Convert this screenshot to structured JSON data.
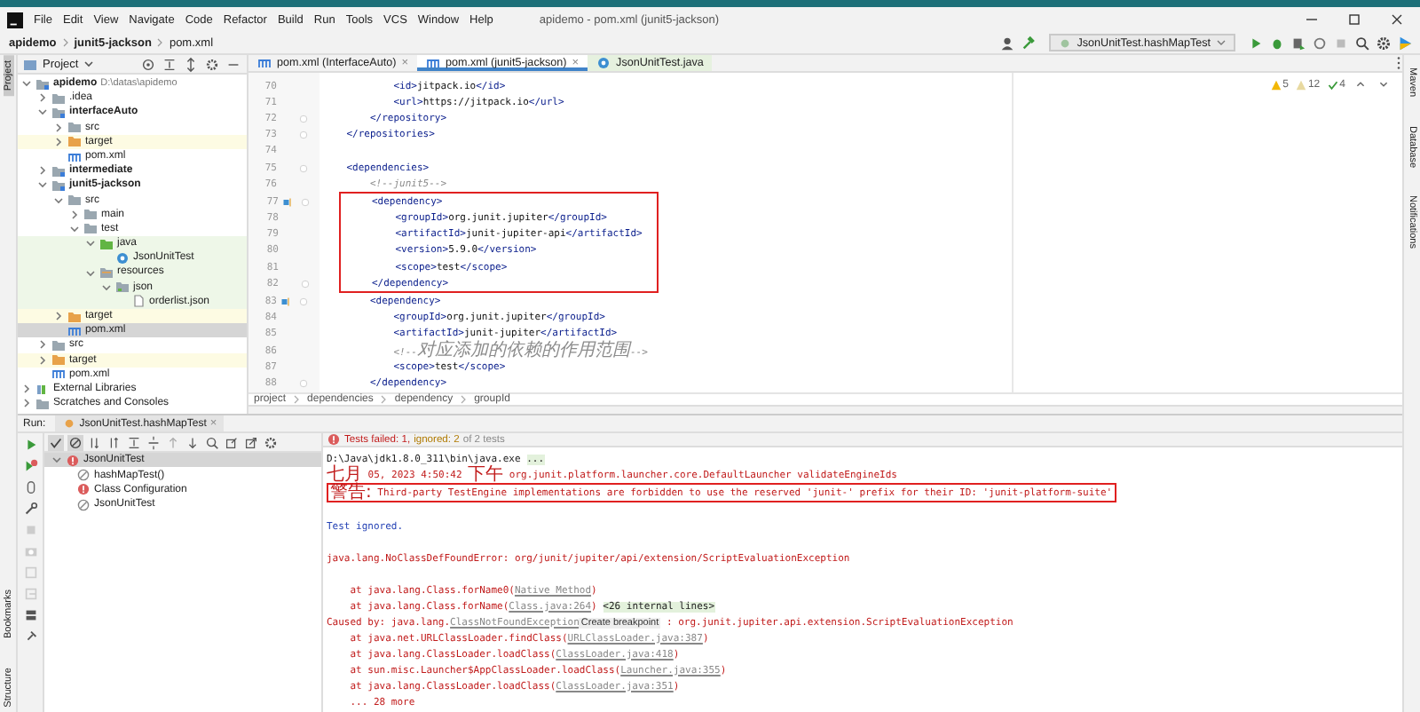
{
  "menu_bar": {
    "items": [
      "File",
      "Edit",
      "View",
      "Navigate",
      "Code",
      "Refactor",
      "Build",
      "Run",
      "Tools",
      "VCS",
      "Window",
      "Help"
    ],
    "title": "apidemo - pom.xml (junit5-jackson)"
  },
  "navigation_bar": {
    "breadcrumbs": [
      "apidemo",
      "junit5-jackson",
      "pom.xml"
    ],
    "run_configuration": "JsonUnitTest.hashMapTest"
  },
  "left_stripe": {
    "top": [
      {
        "label": "Project",
        "selected": true
      }
    ],
    "bottom": [
      {
        "label": "Bookmarks",
        "selected": false
      },
      {
        "label": "Structure",
        "selected": false
      }
    ]
  },
  "right_stripe": [
    "Maven",
    "Database",
    "Notifications"
  ],
  "project_panel": {
    "title": "Project",
    "tree": [
      {
        "label": "apidemo",
        "kind": "module",
        "hint": "D:\\datas\\apidemo",
        "expanded": true,
        "selected": false,
        "children": [
          {
            "label": ".idea",
            "kind": "folder",
            "expanded": false,
            "selected": false
          },
          {
            "label": "interfaceAuto",
            "kind": "module",
            "expanded": true,
            "selected": false,
            "children": [
              {
                "label": "src",
                "kind": "folder",
                "expanded": false,
                "selected": false
              },
              {
                "label": "target",
                "kind": "excluded",
                "expanded": false,
                "selected": false
              },
              {
                "label": "pom.xml",
                "kind": "pom",
                "selected": false
              }
            ]
          },
          {
            "label": "intermediate",
            "kind": "module",
            "expanded": false,
            "selected": false
          },
          {
            "label": "junit5-jackson",
            "kind": "module",
            "expanded": true,
            "selected": false,
            "children": [
              {
                "label": "src",
                "kind": "folder",
                "expanded": true,
                "selected": false,
                "children": [
                  {
                    "label": "main",
                    "kind": "folder",
                    "expanded": false,
                    "selected": false
                  },
                  {
                    "label": "test",
                    "kind": "folder",
                    "expanded": true,
                    "selected": false,
                    "children": [
                      {
                        "label": "java",
                        "kind": "test_source",
                        "expanded": true,
                        "selected": false,
                        "children": [
                          {
                            "label": "JsonUnitTest",
                            "kind": "test_class",
                            "selected": false
                          }
                        ]
                      },
                      {
                        "label": "resources",
                        "kind": "test_resources",
                        "expanded": true,
                        "selected": false,
                        "children": [
                          {
                            "label": "json",
                            "kind": "test_folder",
                            "expanded": true,
                            "selected": false,
                            "children": [
                              {
                                "label": "orderlist.json",
                                "kind": "json",
                                "selected": false
                              }
                            ]
                          }
                        ]
                      }
                    ]
                  }
                ]
              },
              {
                "label": "target",
                "kind": "excluded",
                "expanded": false,
                "selected": false
              },
              {
                "label": "pom.xml",
                "kind": "pom",
                "selected": true
              }
            ]
          },
          {
            "label": "src",
            "kind": "folder",
            "expanded": false,
            "selected": false
          },
          {
            "label": "target",
            "kind": "excluded",
            "expanded": false,
            "selected": false
          },
          {
            "label": "pom.xml",
            "kind": "pom",
            "selected": false
          }
        ]
      },
      {
        "label": "External Libraries",
        "kind": "libraries",
        "expanded": false,
        "selected": false
      },
      {
        "label": "Scratches and Consoles",
        "kind": "scratches",
        "expanded": false,
        "selected": false
      }
    ]
  },
  "editor": {
    "tabs": [
      {
        "label": "pom.xml (InterfaceAuto)",
        "kind": "pom",
        "selected": false,
        "close": "×"
      },
      {
        "label": "pom.xml (junit5-jackson)",
        "kind": "pom",
        "selected": true,
        "close": "×"
      },
      {
        "label": "JsonUnitTest.java",
        "kind": "test_class",
        "selected": false
      }
    ],
    "inspections": [
      {
        "kind": "warning",
        "count": "5"
      },
      {
        "kind": "weak_warning",
        "count": "12"
      },
      {
        "kind": "typo",
        "count": "4"
      }
    ],
    "lines": [
      {
        "number": "70",
        "text": "            <id>jitpack.io</id>"
      },
      {
        "number": "71",
        "text": "            <url>https://jitpack.io</url>"
      },
      {
        "number": "72",
        "text": "        </repository>",
        "fold": true
      },
      {
        "number": "73",
        "text": "    </repositories>",
        "fold": true
      },
      {
        "number": "74"
      },
      {
        "number": "75",
        "text": "    <dependencies>",
        "fold": true
      },
      {
        "number": "76",
        "text": "        <!--junit5-->",
        "kind": "comment"
      },
      {
        "number": "77",
        "text": "        <dependency>",
        "fold": true,
        "gutter_icon": true,
        "boxed": true
      },
      {
        "number": "78",
        "text": "            <groupId>org.junit.jupiter</groupId>",
        "boxed": true
      },
      {
        "number": "79",
        "text": "            <artifactId>junit-jupiter-api</artifactId>",
        "boxed": true
      },
      {
        "number": "80",
        "text": "            <version>5.9.0</version>",
        "boxed": true
      },
      {
        "number": "81",
        "text": "            <scope>test</scope>",
        "boxed": true
      },
      {
        "number": "82",
        "text": "        </dependency>",
        "fold": true,
        "boxed": true
      },
      {
        "number": "83",
        "text": "        <dependency>",
        "fold": true,
        "gutter_icon": true
      },
      {
        "number": "84",
        "text": "            <groupId>org.junit.jupiter</groupId>"
      },
      {
        "number": "85",
        "text": "            <artifactId>junit-jupiter</artifactId>"
      },
      {
        "number": "86",
        "text": "            <!--对应添加的依赖的作用范围-->",
        "kind": "comment"
      },
      {
        "number": "87",
        "text": "            <scope>test</scope>"
      },
      {
        "number": "88",
        "text": "        </dependency>",
        "fold": true
      }
    ],
    "breadcrumbs": [
      "project",
      "dependencies",
      "dependency",
      "groupId"
    ]
  },
  "run_panel": {
    "label": "Run:",
    "tab": {
      "label": "JsonUnitTest.hashMapTest",
      "close": "×",
      "selected": true
    },
    "status": {
      "failed": "Tests failed: 1,",
      "ignored": "ignored: 2",
      "total": "of 2 tests"
    },
    "tests": [
      {
        "label": "JsonUnitTest",
        "kind": "failed",
        "expanded": true,
        "selected": true,
        "children": [
          {
            "label": "hashMapTest()",
            "kind": "ignored",
            "selected": false
          },
          {
            "label": "Class Configuration",
            "kind": "failed",
            "selected": false
          },
          {
            "label": "JsonUnitTest",
            "kind": "ignored",
            "selected": false
          }
        ]
      }
    ],
    "console": [
      {
        "kind": "stdout",
        "segments": [
          {
            "kind": "text",
            "text": "D:\\Java\\jdk1.8.0_311\\bin\\java.exe "
          },
          {
            "kind": "fold",
            "text": "..."
          }
        ]
      },
      {
        "kind": "stderr",
        "segments": [
          {
            "kind": "cjk",
            "text": "七月"
          },
          {
            "kind": "text",
            "text": " 05, 2023 4:50:42 "
          },
          {
            "kind": "cjk",
            "text": "下午"
          },
          {
            "kind": "text",
            "text": " org.junit.platform.launcher.core.DefaultLauncher validateEngineIds"
          }
        ]
      },
      {
        "kind": "stderr",
        "boxed": true,
        "segments": [
          {
            "kind": "cjk",
            "text": "警告:"
          },
          {
            "kind": "text",
            "text": " Third-party TestEngine implementations are forbidden to use the reserved 'junit-' prefix for their ID: 'junit-platform-suite'"
          }
        ]
      },
      {
        "kind": "info",
        "space_before": true,
        "segments": [
          {
            "kind": "text",
            "text": "Test ignored."
          }
        ]
      },
      {
        "kind": "stderr",
        "space_before": true,
        "segments": [
          {
            "kind": "text",
            "text": "java.lang.NoClassDefFoundError: org/junit/jupiter/api/extension/ScriptEvaluationException"
          }
        ]
      },
      {
        "kind": "stderr",
        "space_before": true,
        "segments": [
          {
            "kind": "text",
            "text": "    at java.lang.Class.forName0("
          },
          {
            "kind": "link",
            "text": "Native Method"
          },
          {
            "kind": "text",
            "text": ")"
          }
        ]
      },
      {
        "kind": "stderr",
        "segments": [
          {
            "kind": "text",
            "text": "    at java.lang.Class.forName("
          },
          {
            "kind": "link",
            "text": "Class.java:264"
          },
          {
            "kind": "text",
            "text": ") "
          },
          {
            "kind": "fold",
            "text": "<26 internal lines>"
          }
        ]
      },
      {
        "kind": "stderr",
        "segments": [
          {
            "kind": "text",
            "text": "Caused by: java.lang."
          },
          {
            "kind": "link",
            "text": "ClassNotFoundException"
          },
          {
            "kind": "hint",
            "text": "Create breakpoint"
          },
          {
            "kind": "text",
            "text": " : org.junit.jupiter.api.extension.ScriptEvaluationException"
          }
        ]
      },
      {
        "kind": "stderr",
        "segments": [
          {
            "kind": "text",
            "text": "    at java.net.URLClassLoader.findClass("
          },
          {
            "kind": "link",
            "text": "URLClassLoader.java:387"
          },
          {
            "kind": "text",
            "text": ")"
          }
        ]
      },
      {
        "kind": "stderr",
        "segments": [
          {
            "kind": "text",
            "text": "    at java.lang.ClassLoader.loadClass("
          },
          {
            "kind": "link",
            "text": "ClassLoader.java:418"
          },
          {
            "kind": "text",
            "text": ")"
          }
        ]
      },
      {
        "kind": "stderr",
        "segments": [
          {
            "kind": "text",
            "text": "    at sun.misc.Launcher$AppClassLoader.loadClass("
          },
          {
            "kind": "link",
            "text": "Launcher.java:355"
          },
          {
            "kind": "text",
            "text": ")"
          }
        ]
      },
      {
        "kind": "stderr",
        "segments": [
          {
            "kind": "text",
            "text": "    at java.lang.ClassLoader.loadClass("
          },
          {
            "kind": "link",
            "text": "ClassLoader.java:351"
          },
          {
            "kind": "text",
            "text": ")"
          }
        ]
      },
      {
        "kind": "stderr",
        "segments": [
          {
            "kind": "text",
            "text": "    ... 28 more"
          }
        ]
      }
    ]
  }
}
